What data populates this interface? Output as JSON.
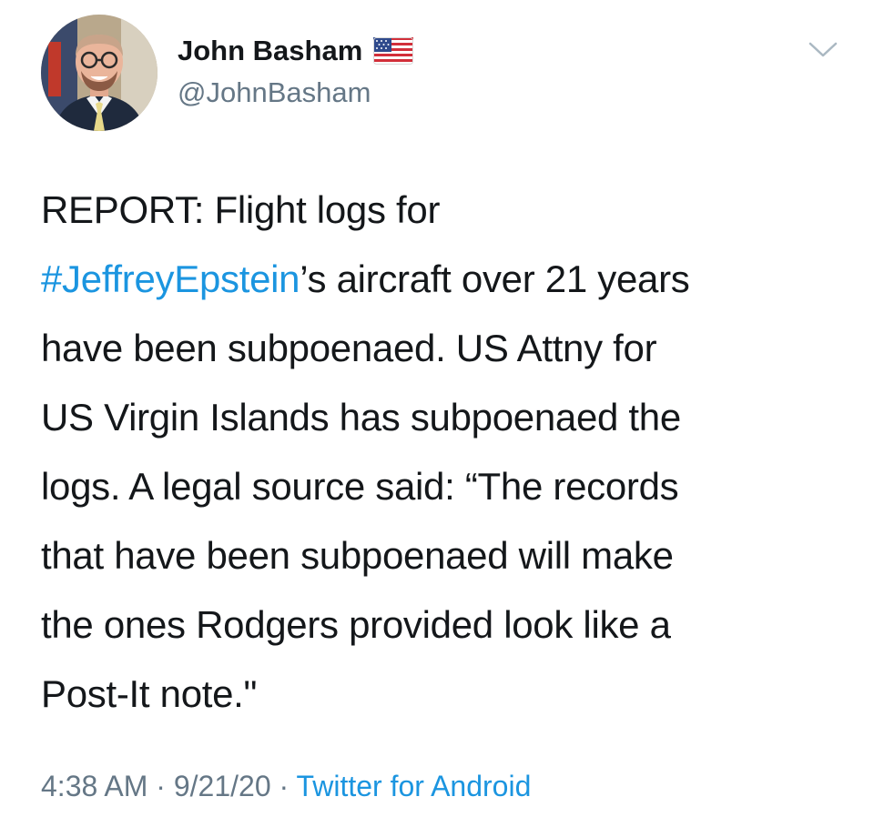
{
  "user": {
    "display_name": "John Basham",
    "handle": "@JohnBasham",
    "badge_icon": "us-flag-icon"
  },
  "tweet": {
    "lines": [
      {
        "before": "REPORT: Flight logs for",
        "hashtag": "",
        "after": ""
      },
      {
        "before": "",
        "hashtag": "#JeffreyEpstein",
        "after": "’s aircraft over 21 years"
      },
      {
        "before": "have been subpoenaed. US Attny for",
        "hashtag": "",
        "after": ""
      },
      {
        "before": "US Virgin Islands has subpoenaed the",
        "hashtag": "",
        "after": ""
      },
      {
        "before": "logs. A legal source said: “The records",
        "hashtag": "",
        "after": ""
      },
      {
        "before": "that have been subpoenaed will make",
        "hashtag": "",
        "after": ""
      },
      {
        "before": "the ones Rodgers provided look like a",
        "hashtag": "",
        "after": ""
      },
      {
        "before": "Post-It note.\"",
        "hashtag": "",
        "after": ""
      }
    ]
  },
  "meta": {
    "time": "4:38 AM",
    "separator": " · ",
    "date": "9/21/20",
    "source": "Twitter for Android"
  },
  "colors": {
    "link": "#1b95e0",
    "secondary_text": "#657786",
    "primary_text": "#14171a"
  },
  "icons": {
    "menu": "chevron-down-icon"
  }
}
